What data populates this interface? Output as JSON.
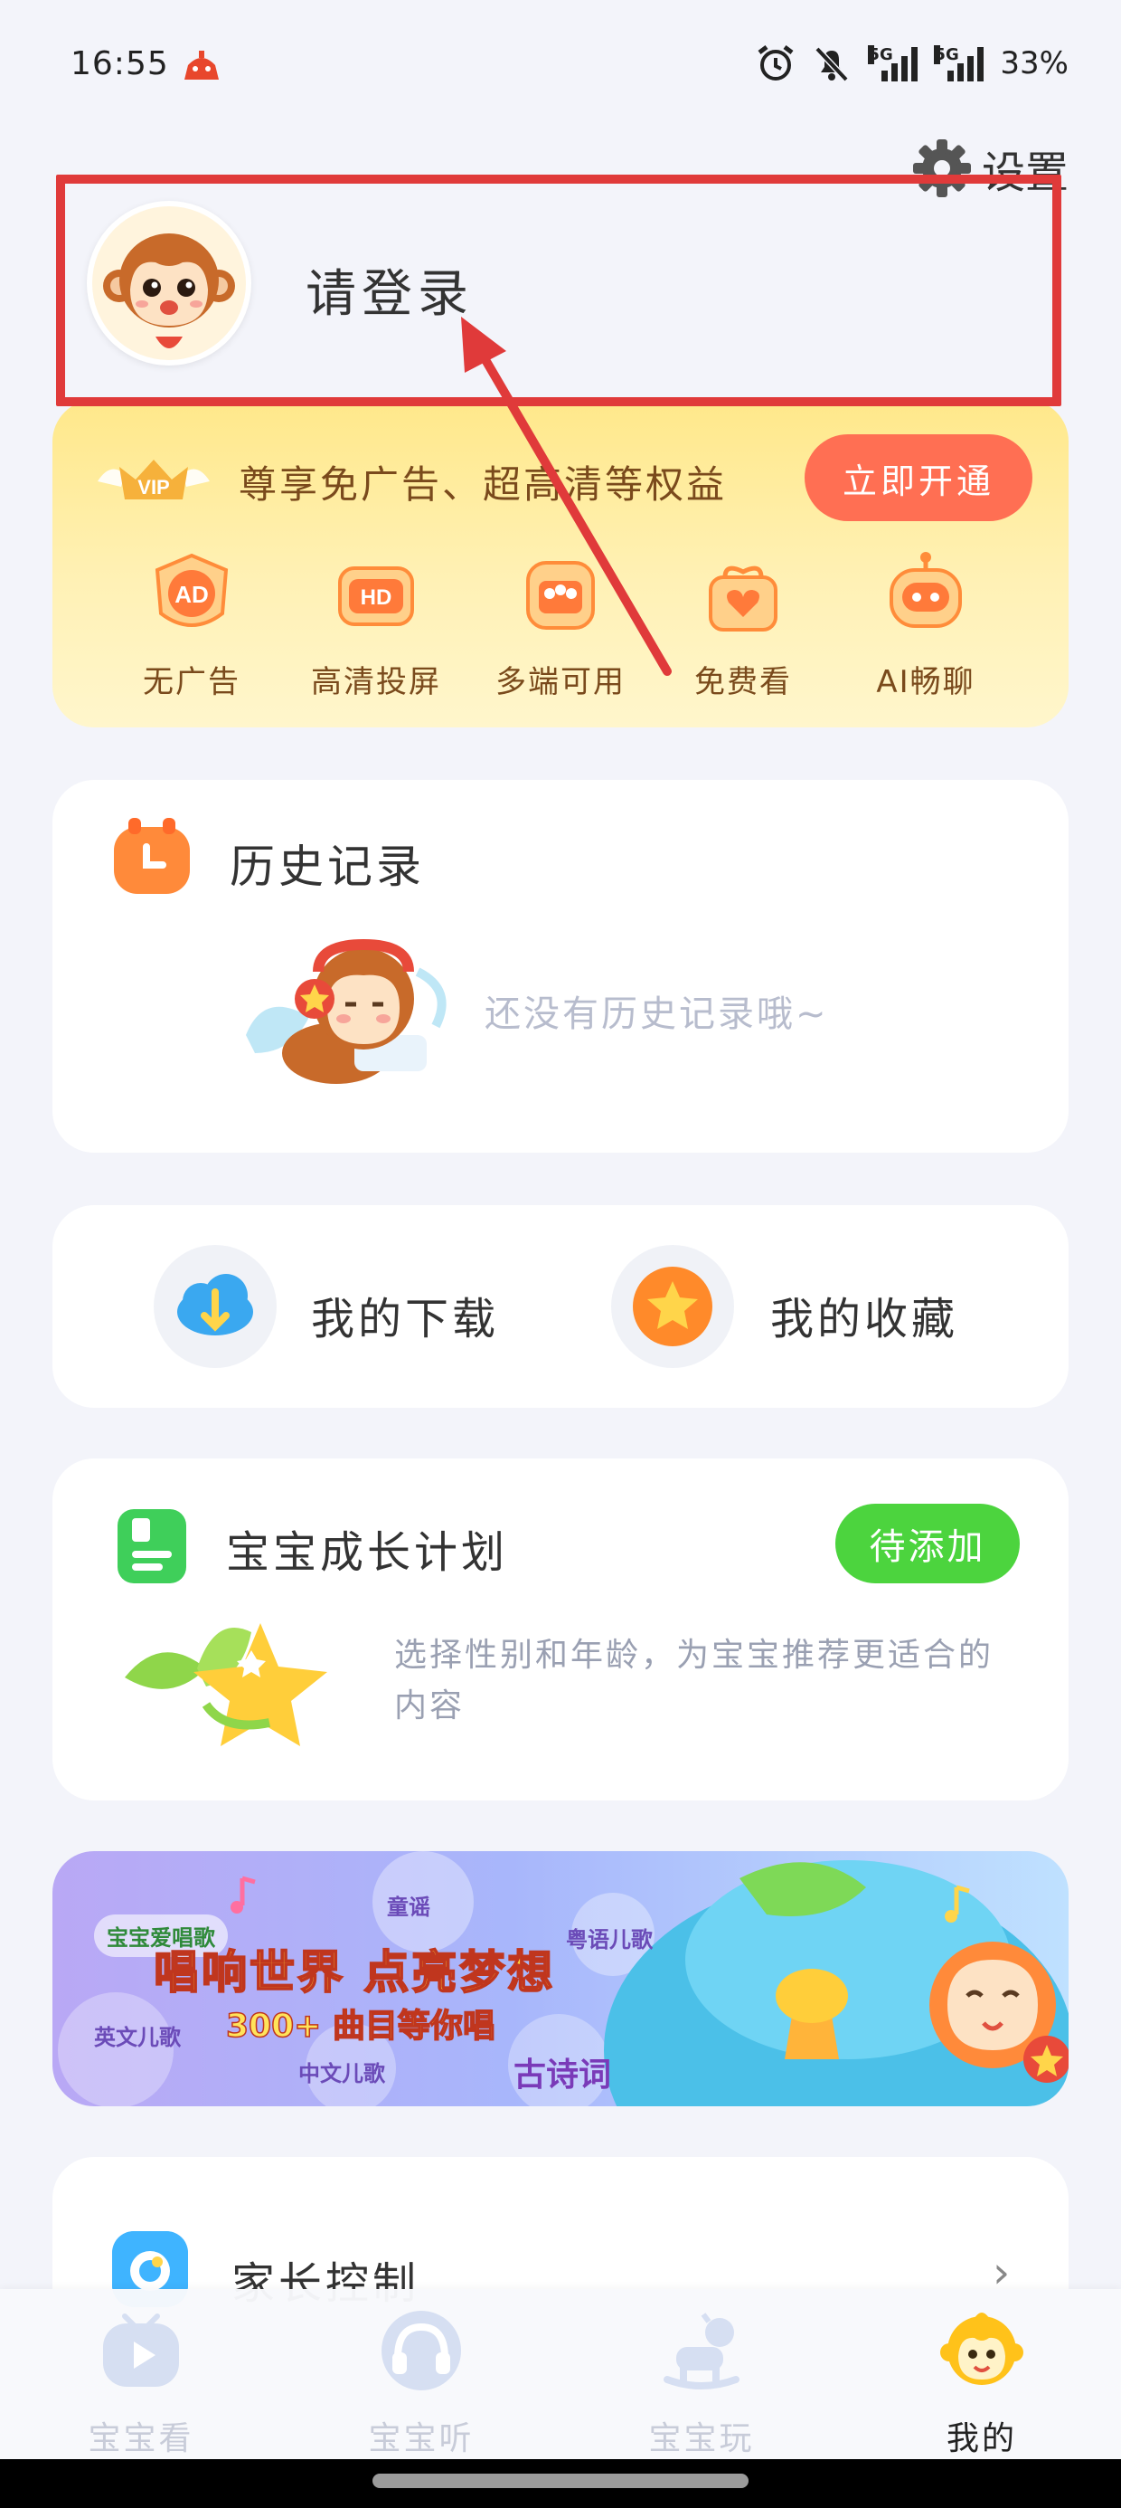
{
  "status_bar": {
    "time": "16:55",
    "battery": "33%",
    "network1": "5G",
    "network2": "5G",
    "icons": [
      "alarm-icon",
      "mute-icon",
      "signal-icon",
      "signal-icon"
    ]
  },
  "header": {
    "settings_label": "设置",
    "login_text": "请登录"
  },
  "vip": {
    "badge": "VIP",
    "description": "尊享免广告、超高清等权益",
    "cta": "立即开通",
    "benefits": [
      {
        "label": "无广告",
        "icon": "ad-icon",
        "glyph": "AD"
      },
      {
        "label": "高清投屏",
        "icon": "hd-icon",
        "glyph": "HD"
      },
      {
        "label": "多端可用",
        "icon": "multi-device-icon",
        "glyph": ""
      },
      {
        "label": "免费看",
        "icon": "heart-gift-icon",
        "glyph": "♥"
      },
      {
        "label": "AI畅聊",
        "icon": "robot-icon",
        "glyph": ""
      }
    ]
  },
  "history": {
    "title": "历史记录",
    "empty_text": "还没有历史记录哦~"
  },
  "quick_links": {
    "downloads": "我的下载",
    "favorites": "我的收藏"
  },
  "growth": {
    "title": "宝宝成长计划",
    "button": "待添加",
    "description": "选择性别和年龄，为宝宝推荐更适合的内容"
  },
  "banner": {
    "brand": "宝宝爱唱歌",
    "headline": "唱响世界 点亮梦想",
    "subline": "300+ 曲目等你唱",
    "tags": [
      "童谣",
      "粤语儿歌",
      "英文儿歌",
      "中文儿歌",
      "古诗词"
    ]
  },
  "parent_control": {
    "title": "家长控制",
    "chevron": "›"
  },
  "tabs": [
    {
      "label": "宝宝看",
      "icon": "play-tv-icon",
      "active": false
    },
    {
      "label": "宝宝听",
      "icon": "headphones-icon",
      "active": false
    },
    {
      "label": "宝宝玩",
      "icon": "rocking-horse-icon",
      "active": false
    },
    {
      "label": "我的",
      "icon": "monkey-face-icon",
      "active": true
    }
  ],
  "colors": {
    "highlight": "#e03a3a",
    "vip_button": "#ff6f53",
    "growth_button": "#4cd43e",
    "arrow": "#e03a3a"
  }
}
